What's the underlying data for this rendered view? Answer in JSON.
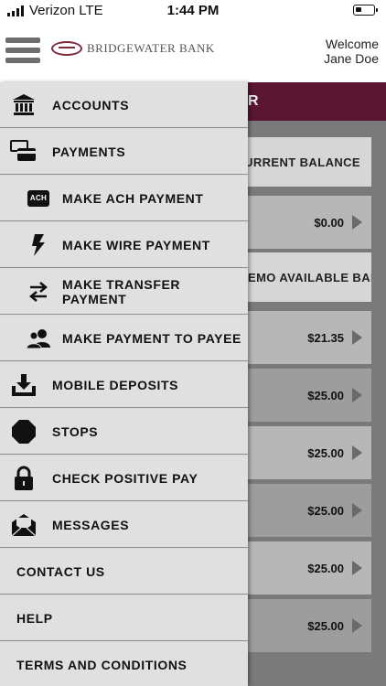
{
  "status_bar": {
    "carrier": "Verizon LTE",
    "time": "1:44 PM"
  },
  "header": {
    "bank_name": "BRIDGEWATER BANK",
    "welcome_line1": "Welcome",
    "welcome_line2": "Jane Doe"
  },
  "background": {
    "title_fragment": "R",
    "col_headers": [
      "CURRENT BALANCE",
      "EMO AVAILABLE BALA..."
    ],
    "first_balance": "$0.00",
    "balances": [
      "$21.35",
      "$25.00",
      "$25.00",
      "$25.00",
      "$25.00",
      "$25.00"
    ]
  },
  "menu": {
    "accounts": "ACCOUNTS",
    "payments": "PAYMENTS",
    "make_ach_payment": "MAKE ACH PAYMENT",
    "ach_badge": "ACH",
    "make_wire_payment": "MAKE WIRE PAYMENT",
    "make_transfer_payment": "MAKE TRANSFER PAYMENT",
    "make_payment_to_payee": "MAKE PAYMENT TO PAYEE",
    "mobile_deposits": "MOBILE DEPOSITS",
    "stops": "STOPS",
    "check_positive_pay": "CHECK POSITIVE PAY",
    "messages": "MESSAGES",
    "contact_us": "CONTACT US",
    "help": "HELP",
    "terms_and_conditions": "TERMS AND CONDITIONS"
  },
  "colors": {
    "brand": "#5a1531",
    "drawer_bg": "#e0e0e0"
  }
}
